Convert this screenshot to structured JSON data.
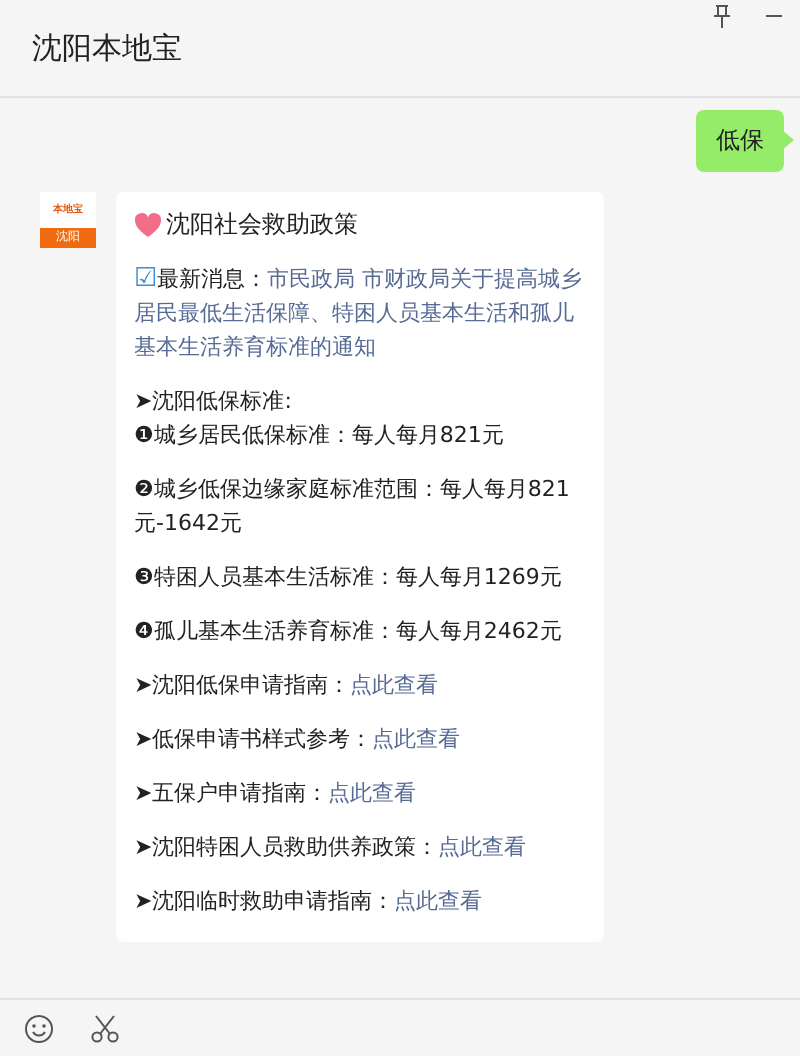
{
  "window": {
    "title": "沈阳本地宝"
  },
  "messages": [
    {
      "kind": "sent",
      "text": "低保"
    },
    {
      "kind": "card",
      "avatar": {
        "top": "本地宝",
        "bottom": "沈阳"
      },
      "title": "沈阳社会救助政策",
      "news": {
        "icon": "☑",
        "label": "最新消息：",
        "link": "市民政局 市财政局关于提高城乡居民最低生活保障、特困人员基本生活和孤儿基本生活养育标准的通知"
      },
      "paragraphs": [
        {
          "kind": "text",
          "lines": [
            "➤沈阳低保标准:",
            "❶城乡居民低保标准：每人每月821元"
          ]
        },
        {
          "kind": "text",
          "lines": [
            "❷城乡低保边缘家庭标准范围：每人每月821元-1642元"
          ]
        },
        {
          "kind": "text",
          "lines": [
            "❸特困人员基本生活标准：每人每月1269元"
          ]
        },
        {
          "kind": "text",
          "lines": [
            "❹孤儿基本生活养育标准：每人每月2462元"
          ]
        },
        {
          "kind": "link",
          "text": "➤沈阳低保申请指南：",
          "link": "点此查看"
        },
        {
          "kind": "link",
          "text": "➤低保申请书样式参考：",
          "link": "点此查看"
        },
        {
          "kind": "link",
          "text": "➤五保户申请指南：",
          "link": "点此查看"
        },
        {
          "kind": "link",
          "text": "➤沈阳特困人员救助供养政策：",
          "link": "点此查看"
        },
        {
          "kind": "link",
          "text": "➤沈阳临时救助申请指南：",
          "link": "点此查看"
        }
      ]
    }
  ]
}
